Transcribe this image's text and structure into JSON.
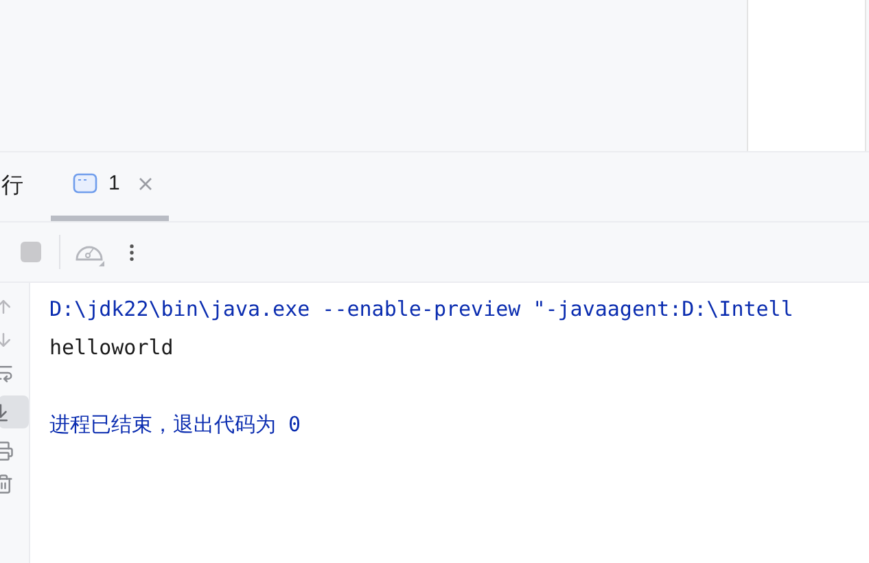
{
  "tool_window": {
    "title": "行"
  },
  "tabs": [
    {
      "label": "1",
      "selected": true
    }
  ],
  "console": {
    "lines": [
      {
        "kind": "command",
        "text": "D:\\jdk22\\bin\\java.exe --enable-preview \"-javaagent:D:\\Intell"
      },
      {
        "kind": "output",
        "text": "helloworld"
      },
      {
        "kind": "blank"
      },
      {
        "kind": "system",
        "text": "进程已结束，退出代码为 0"
      }
    ]
  }
}
